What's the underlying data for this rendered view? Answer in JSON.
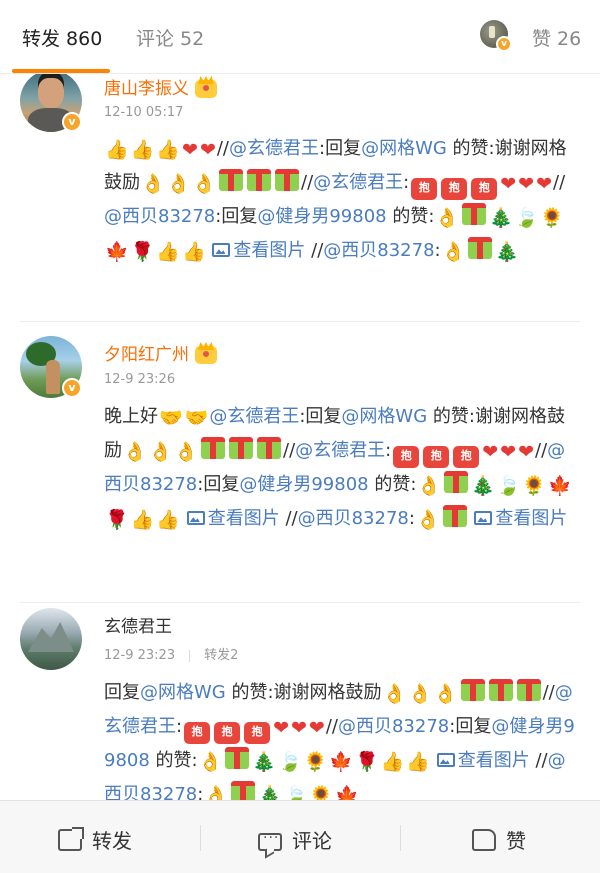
{
  "tabs": {
    "repost": "转发 860",
    "comment": "评论 52",
    "like": "赞 26"
  },
  "items": [
    {
      "user": "唐山李振义",
      "time": "12-10 05:17",
      "repost_count": "",
      "text": {
        "p1": "//",
        "m1": "@玄德君王",
        "p2": ":回复",
        "m2": "@网格WG",
        "p3": " 的赞:谢谢网格鼓励",
        "p4": "//",
        "m3": "@玄德君王",
        "p5": ":",
        "p6": "//",
        "m4": "@西贝83278",
        "p7": ":回复",
        "m5": "@健身男99808",
        "p8": " 的赞:",
        "link1": "查看图片",
        "p9": " //",
        "m6": "@西贝83278",
        "p10": ":"
      }
    },
    {
      "user": "夕阳红广州",
      "time": "12-9 23:26",
      "repost_count": "",
      "text": {
        "p0": "晚上好",
        "m1": "@玄德君王",
        "p2": ":回复",
        "m2": "@网格WG",
        "p3": " 的赞:谢谢网格鼓励",
        "p4": "//",
        "m3": "@玄德君王",
        "p5": ":",
        "p6": "//",
        "m4": "@西贝83278",
        "p7": ":回复",
        "m5": "@健身男99808",
        "p8": " 的赞:",
        "link1": "查看图片",
        "p9": " //",
        "m6": "@西贝83278",
        "p10": ":",
        "link2": "查看图片"
      }
    },
    {
      "user": "玄德君王",
      "time": "12-9 23:23",
      "repost_count": "转发2",
      "text": {
        "p0": "回复",
        "m1": "@网格WG",
        "p1": " 的赞:谢谢网格鼓励",
        "p2": "//",
        "m2": "@玄德君王",
        "p3": ":",
        "p4": "//",
        "m3": "@西贝83278",
        "p5": ":回复",
        "m4": "@健身男99808",
        "p6": " 的赞:",
        "link1": "查看图片",
        "p7": " //",
        "m5": "@西贝83278",
        "p8": ":"
      }
    }
  ],
  "emoji": {
    "thumb": "👍",
    "heart": "❤",
    "ok": "👌",
    "tree": "🎄",
    "leaf": "🍃",
    "sunflower": "🌻",
    "maple": "🍁",
    "rose": "🌹",
    "shake": "🤝",
    "point": "👌",
    "hug": "抱"
  },
  "bottombar": {
    "repost": "转发",
    "comment": "评论",
    "like": "赞"
  },
  "colors": {
    "accent": "#ff8200",
    "mention": "#4a7cbf",
    "vip_name": "#f86f07"
  }
}
